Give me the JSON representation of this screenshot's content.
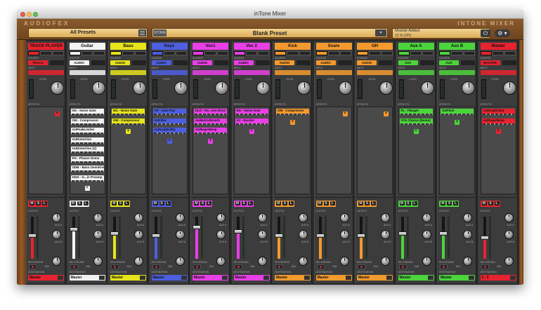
{
  "window": {
    "title": "inTone Mixer"
  },
  "header": {
    "brand_left": "AUDIOFEX",
    "brand_right": "INTONE MIXER",
    "presets_label": "All Presets",
    "preset_name": "Blank Preset",
    "store_label": "STORE",
    "status_line1": "Module Added",
    "status_line2": "12 % CPU",
    "power_label": "⏻",
    "gear_label": "⚙ ▾"
  },
  "labels": {
    "source": "SOURCE",
    "input": "INPUT",
    "level": "LEVEL",
    "effects": "EFFECTS",
    "output": "OUTPUT",
    "recording": "RECORDING",
    "destination": "DESTINATION",
    "aux_a": "AUX A",
    "aux_b": "AUX B",
    "bal": "BAL"
  },
  "channels": [
    {
      "name": "TRACK PLAYER",
      "color": "#e8232f",
      "source": "TRACK",
      "effects": [],
      "destination": "Master",
      "fader_level": 0.55
    },
    {
      "name": "Guitar",
      "color": "#f2f2f2",
      "source": "AUDIO",
      "effects": [
        "NG - Noise Gate",
        "OM - Compressor",
        "AUPeakLimiter",
        "AUDistortion",
        "AUDistortion [2]",
        "PH - Phaser Demo",
        "ODB - Bass Overdrive",
        "HGD - G...in Preamp"
      ],
      "destination": "Master",
      "fader_level": 0.7
    },
    {
      "name": "Bass",
      "color": "#e6e41a",
      "source": "AUDIO",
      "effects": [
        "NG - Noise Gate",
        "OM - Compressor"
      ],
      "destination": "Master",
      "fader_level": 0.6
    },
    {
      "name": "Keys",
      "color": "#4d5fe0",
      "source": "AUDIO",
      "effects": [
        "AP - Auto Pan",
        "AUFilter",
        "AUGraphicEQ"
      ],
      "destination": "Master",
      "fader_level": 0.55
    },
    {
      "name": "Voc1",
      "color": "#e93fe6",
      "source": "AUDIO",
      "effects": [
        "DLD - De...ues Drive",
        "AUMatrixReverb",
        "AURogerBeep"
      ],
      "destination": "Master",
      "fader_level": 0.75
    },
    {
      "name": "Voc 2",
      "color": "#e93fe6",
      "source": "AUDIO",
      "effects": [
        "NG - Noise Gate",
        "XC - Exciter"
      ],
      "destination": "Master",
      "fader_level": 0.65
    },
    {
      "name": "Kick",
      "color": "#f39a2e",
      "source": "AUDIO",
      "effects": [
        "OM - Compressor"
      ],
      "destination": "Master",
      "fader_level": 0.55
    },
    {
      "name": "Snare",
      "color": "#f39a2e",
      "source": "AUDIO",
      "effects": [],
      "destination": "Master",
      "fader_level": 0.55
    },
    {
      "name": "OH",
      "color": "#f39a2e",
      "source": "AUDIO",
      "effects": [],
      "destination": "Master",
      "fader_level": 0.55
    },
    {
      "name": "Aux A",
      "color": "#4cd43c",
      "source": "AUX",
      "effects": [
        "FL - Flanger",
        "STA Chorus (Demo)"
      ],
      "destination": "Master",
      "fader_level": 0.6
    },
    {
      "name": "Aux B",
      "color": "#4cd43c",
      "source": "AUX",
      "effects": [
        "AUPitch"
      ],
      "destination": "Master",
      "fader_level": 0.6
    },
    {
      "name": "Master",
      "color": "#e8232f",
      "source": "MASTER",
      "effects": [
        "AUGraphicEQ",
        "AURogerBeep"
      ],
      "destination": "1 - 2",
      "fader_level": 0.5
    }
  ]
}
